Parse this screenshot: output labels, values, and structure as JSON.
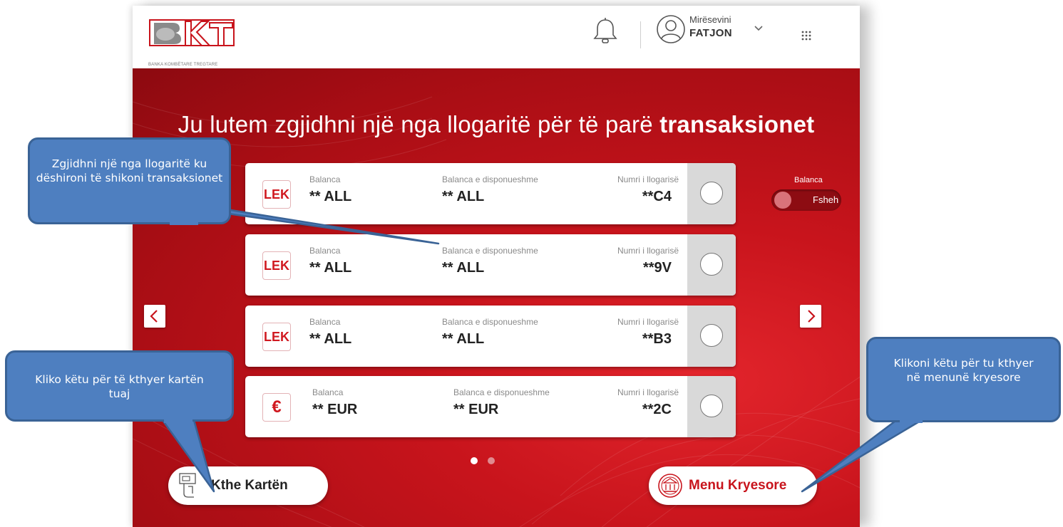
{
  "header": {
    "logo_text": "BANKA KOMBËTARE TREGTARE",
    "logo_letters": "BKT",
    "welcome": "Mirësevini",
    "username": "FATJON",
    "icons": [
      "bell-icon",
      "user-icon",
      "chevron-down-icon",
      "grid-menu-icon"
    ]
  },
  "main": {
    "title_prefix": "Ju lutem zgjidhni një nga llogaritë për të parë",
    "title_bold": "transaksionet",
    "toggle": {
      "label": "Balanca",
      "text": "Fsheh"
    },
    "accounts": [
      {
        "currency": "LEK",
        "balance_label": "Balanca",
        "balance": "** ALL",
        "available_label": "Balanca e disponueshme",
        "available": "** ALL",
        "number_label": "Numri i llogarisë",
        "number": "**C4"
      },
      {
        "currency": "LEK",
        "balance_label": "Balanca",
        "balance": "** ALL",
        "available_label": "Balanca e disponueshme",
        "available": "** ALL",
        "number_label": "Numri i llogarisë",
        "number": "**9V"
      },
      {
        "currency": "LEK",
        "balance_label": "Balanca",
        "balance": "** ALL",
        "available_label": "Balanca e disponueshme",
        "available": "** ALL",
        "number_label": "Numri i llogarisë",
        "number": "**B3"
      },
      {
        "currency": "€",
        "balance_label": "Balanca",
        "balance": "** EUR",
        "available_label": "Balanca e disponueshme",
        "available": "** EUR",
        "number_label": "Numri i llogarisë",
        "number": "**2C"
      }
    ],
    "pagination": {
      "pages": 2,
      "current": 1
    },
    "buttons": {
      "return_card": "Kthe Kartën",
      "main_menu": "Menu Kryesore"
    }
  },
  "callouts": {
    "select_account": "Zgjidhni një nga llogaritë ku dëshironi të  shikoni transaksionet",
    "return_card": "Kliko këtu për të kthyer kartën tuaj",
    "main_menu": "Klikoni këtu për tu kthyer në menunë kryesore"
  },
  "colors": {
    "brand_red": "#c8141c",
    "callout_blue": "#4e7fc0",
    "callout_border": "#3a6396"
  }
}
